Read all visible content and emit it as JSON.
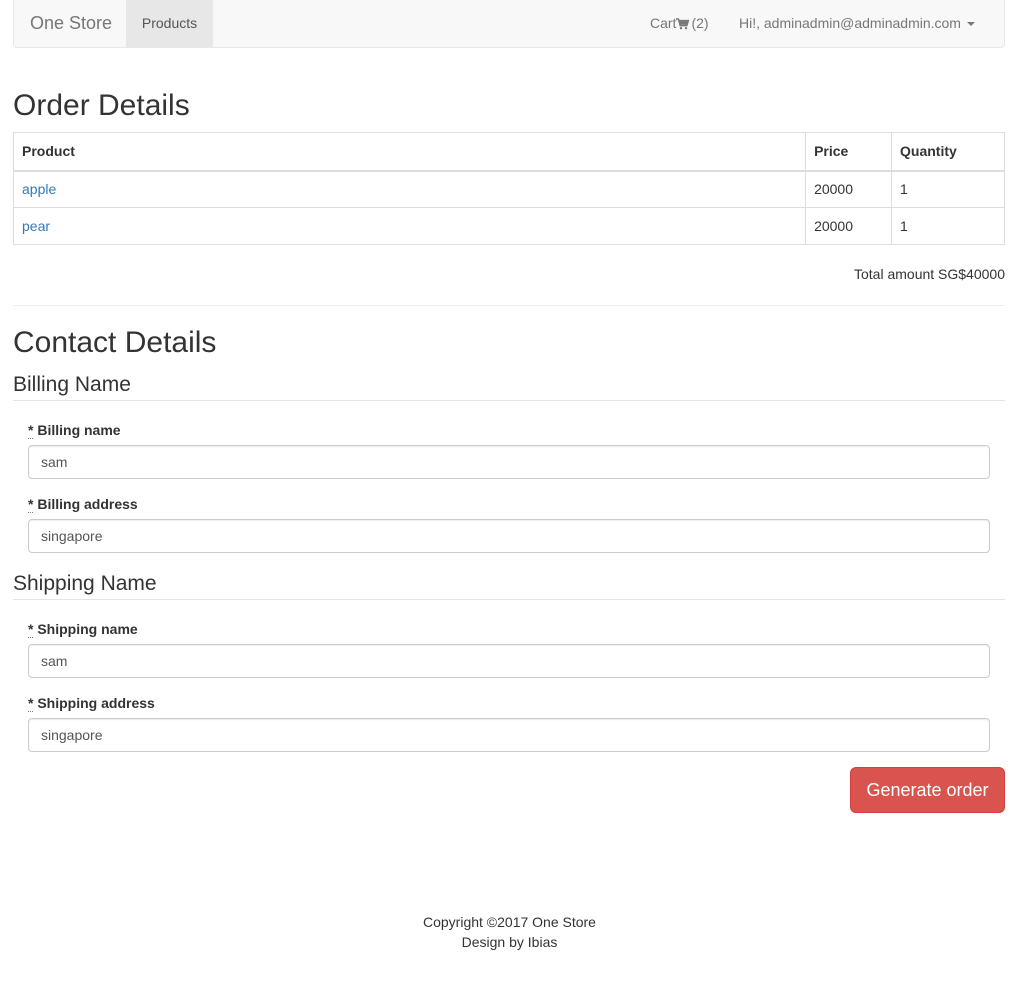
{
  "navbar": {
    "brand": "One Store",
    "products_label": "Products",
    "cart_label": "Cart",
    "cart_count": "(2)",
    "user_label": "Hi!, adminadmin@adminadmin.com"
  },
  "order": {
    "title": "Order Details",
    "columns": [
      "Product",
      "Price",
      "Quantity"
    ],
    "rows": [
      {
        "product": "apple",
        "price": "20000",
        "quantity": "1"
      },
      {
        "product": "pear",
        "price": "20000",
        "quantity": "1"
      }
    ],
    "total": "Total amount SG$40000"
  },
  "contact": {
    "title": "Contact Details",
    "billing": {
      "heading": "Billing Name",
      "name_label": "Billing name",
      "name_value": "sam",
      "address_label": "Billing address",
      "address_value": "singapore"
    },
    "shipping": {
      "heading": "Shipping Name",
      "name_label": "Shipping name",
      "name_value": "sam",
      "address_label": "Shipping address",
      "address_value": "singapore"
    },
    "required_mark": "*"
  },
  "actions": {
    "generate_label": "Generate order"
  },
  "footer": {
    "copyright": "Copyright ©2017 One Store",
    "design": "Design by Ibias"
  },
  "colors": {
    "link": "#337ab7",
    "danger": "#d9534f",
    "navbar_bg": "#f8f8f8"
  },
  "icons": {
    "cart": "shopping-cart-icon",
    "caret": "caret-down-icon"
  }
}
